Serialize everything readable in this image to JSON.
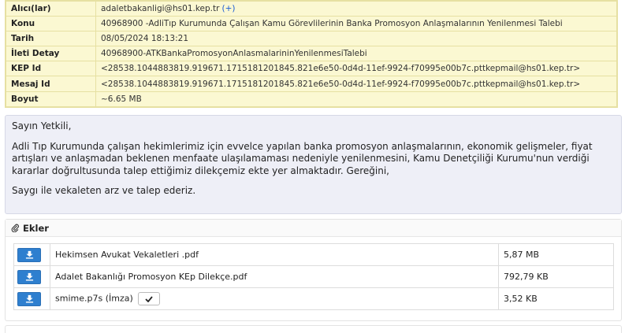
{
  "header": {
    "rows": [
      {
        "key": "Alıcı(lar)",
        "value": "adaletbakanligi@hs01.kep.tr",
        "extra": "(+)"
      },
      {
        "key": "Konu",
        "value": "40968900 -AdliTıp Kurumunda Çalışan Kamu Görevlilerinin Banka Promosyon Anlaşmalarının Yenilenmesi Talebi"
      },
      {
        "key": "Tarih",
        "value": "08/05/2024 18:13:21"
      },
      {
        "key": "İleti Detay",
        "value": "40968900-ATKBankaPromosyonAnlasmalarininYenilenmesiTalebi"
      },
      {
        "key": "KEP Id",
        "value": "<28538.1044883819.919671.1715181201845.821e6e50-0d4d-11ef-9924-f70995e00b7c.pttkepmail@hs01.kep.tr>"
      },
      {
        "key": "Mesaj Id",
        "value": "<28538.1044883819.919671.1715181201845.821e6e50-0d4d-11ef-9924-f70995e00b7c.pttkepmail@hs01.kep.tr>"
      },
      {
        "key": "Boyut",
        "value": "~6.65 MB"
      }
    ]
  },
  "message": {
    "greeting": "Sayın Yetkili,",
    "body": "Adli Tıp Kurumunda çalışan hekimlerimiz için evvelce yapılan banka promosyon anlaşmalarının, ekonomik gelişmeler, fiyat artışları ve anlaşmadan beklenen menfaate ulaşılamaması nedeniyle yenilenmesini, Kamu Denetçiliği Kurumu'nun verdiği kararlar doğrultusunda talep ettiğimiz dilekçemiz ekte yer almaktadır. Gereğini,",
    "closing": "Saygı ile vekaleten arz ve talep ederiz."
  },
  "attachments": {
    "title": "Ekler",
    "items": [
      {
        "name": "Hekimsen Avukat Vekaletleri .pdf",
        "size": "5,87 MB"
      },
      {
        "name": "Adalet Bakanlığı Promosyon KEp Dilekçe.pdf",
        "size": "792,79 KB"
      },
      {
        "name": "smime.p7s (İmza)",
        "size": "3,52 KB"
      }
    ]
  },
  "icons": {
    "paperclip": "paperclip-icon",
    "download": "download-icon",
    "check": "check-icon"
  },
  "colors": {
    "header_bg": "#fbf8d2",
    "message_bg": "#eeeff7",
    "download_btn": "#2e7fcf",
    "link": "#1a5bd6"
  }
}
